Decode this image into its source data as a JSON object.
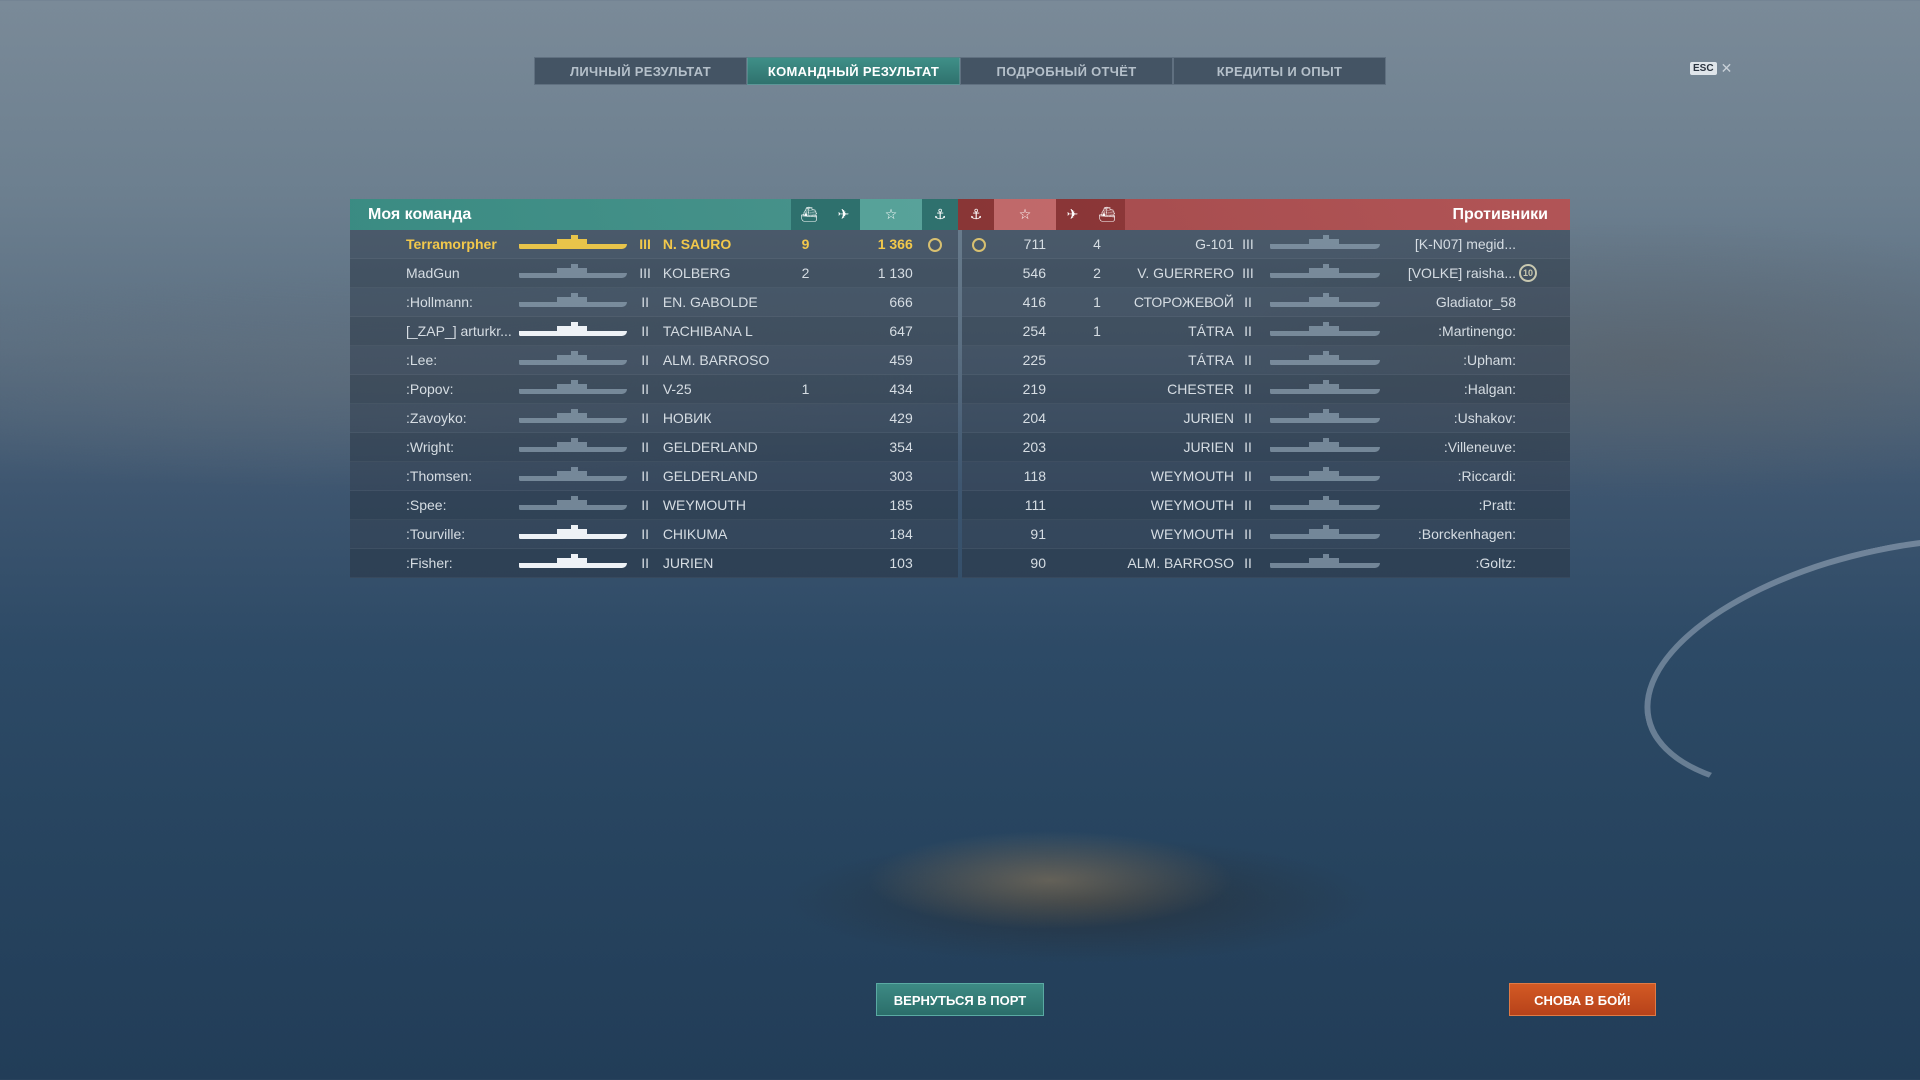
{
  "tabs": [
    {
      "label": "ЛИЧНЫЙ РЕЗУЛЬТАТ"
    },
    {
      "label": "КОМАНДНЫЙ РЕЗУЛЬТАТ"
    },
    {
      "label": "ПОДРОБНЫЙ ОТЧЁТ"
    },
    {
      "label": "КРЕДИТЫ И ОПЫТ"
    }
  ],
  "esc_label": "ESC",
  "my_team": {
    "title": "Моя команда",
    "players": [
      {
        "name": "Terramorpher",
        "tier": "III",
        "ship": "N. SAURO",
        "kills": "9",
        "exp": "1 366"
      },
      {
        "name": "MadGun",
        "tier": "III",
        "ship": "KOLBERG",
        "kills": "2",
        "exp": "1 130"
      },
      {
        "name": ":Hollmann:",
        "tier": "II",
        "ship": "EN. GABOLDE",
        "kills": "",
        "exp": "666"
      },
      {
        "name": "[_ZAP_] arturkr...",
        "tier": "II",
        "ship": "TACHIBANA L",
        "kills": "",
        "exp": "647"
      },
      {
        "name": ":Lee:",
        "tier": "II",
        "ship": "ALM. BARROSO",
        "kills": "",
        "exp": "459"
      },
      {
        "name": ":Popov:",
        "tier": "II",
        "ship": "V-25",
        "kills": "1",
        "exp": "434"
      },
      {
        "name": ":Zavoyko:",
        "tier": "II",
        "ship": "НОВИК",
        "kills": "",
        "exp": "429"
      },
      {
        "name": ":Wright:",
        "tier": "II",
        "ship": "GELDERLAND",
        "kills": "",
        "exp": "354"
      },
      {
        "name": ":Thomsen:",
        "tier": "II",
        "ship": "GELDERLAND",
        "kills": "",
        "exp": "303"
      },
      {
        "name": ":Spee:",
        "tier": "II",
        "ship": "WEYMOUTH",
        "kills": "",
        "exp": "185"
      },
      {
        "name": ":Tourville:",
        "tier": "II",
        "ship": "CHIKUMA",
        "kills": "",
        "exp": "184"
      },
      {
        "name": ":Fisher:",
        "tier": "II",
        "ship": "JURIEN",
        "kills": "",
        "exp": "103"
      }
    ]
  },
  "enemies": {
    "title": "Противники",
    "players": [
      {
        "exp": "711",
        "kills": "4",
        "ship": "G-101",
        "tier": "III",
        "name": "[K-N07] megid...",
        "badge": ""
      },
      {
        "exp": "546",
        "kills": "2",
        "ship": "V. GUERRERO",
        "tier": "III",
        "name": "[VOLKE] raisha...",
        "badge": "10"
      },
      {
        "exp": "416",
        "kills": "1",
        "ship": "СТОРОЖЕВОЙ",
        "tier": "II",
        "name": "Gladiator_58",
        "badge": ""
      },
      {
        "exp": "254",
        "kills": "1",
        "ship": "TÁTRA",
        "tier": "II",
        "name": ":Martinengo:",
        "badge": ""
      },
      {
        "exp": "225",
        "kills": "",
        "ship": "TÁTRA",
        "tier": "II",
        "name": ":Upham:",
        "badge": ""
      },
      {
        "exp": "219",
        "kills": "",
        "ship": "CHESTER",
        "tier": "II",
        "name": ":Halgan:",
        "badge": ""
      },
      {
        "exp": "204",
        "kills": "",
        "ship": "JURIEN",
        "tier": "II",
        "name": ":Ushakov:",
        "badge": ""
      },
      {
        "exp": "203",
        "kills": "",
        "ship": "JURIEN",
        "tier": "II",
        "name": ":Villeneuve:",
        "badge": ""
      },
      {
        "exp": "118",
        "kills": "",
        "ship": "WEYMOUTH",
        "tier": "II",
        "name": ":Riccardi:",
        "badge": ""
      },
      {
        "exp": "111",
        "kills": "",
        "ship": "WEYMOUTH",
        "tier": "II",
        "name": ":Pratt:",
        "badge": ""
      },
      {
        "exp": "91",
        "kills": "",
        "ship": "WEYMOUTH",
        "tier": "II",
        "name": ":Borckenhagen:",
        "badge": ""
      },
      {
        "exp": "90",
        "kills": "",
        "ship": "ALM. BARROSO",
        "tier": "II",
        "name": ":Goltz:",
        "badge": ""
      }
    ]
  },
  "buttons": {
    "port": "ВЕРНУТЬСЯ В ПОРТ",
    "battle": "СНОВА В БОЙ!"
  },
  "colors": {
    "my_team": "#3f8f88",
    "enemies": "#b45050",
    "highlight": "#f2c84b",
    "battle_button": "#c94d1f"
  }
}
